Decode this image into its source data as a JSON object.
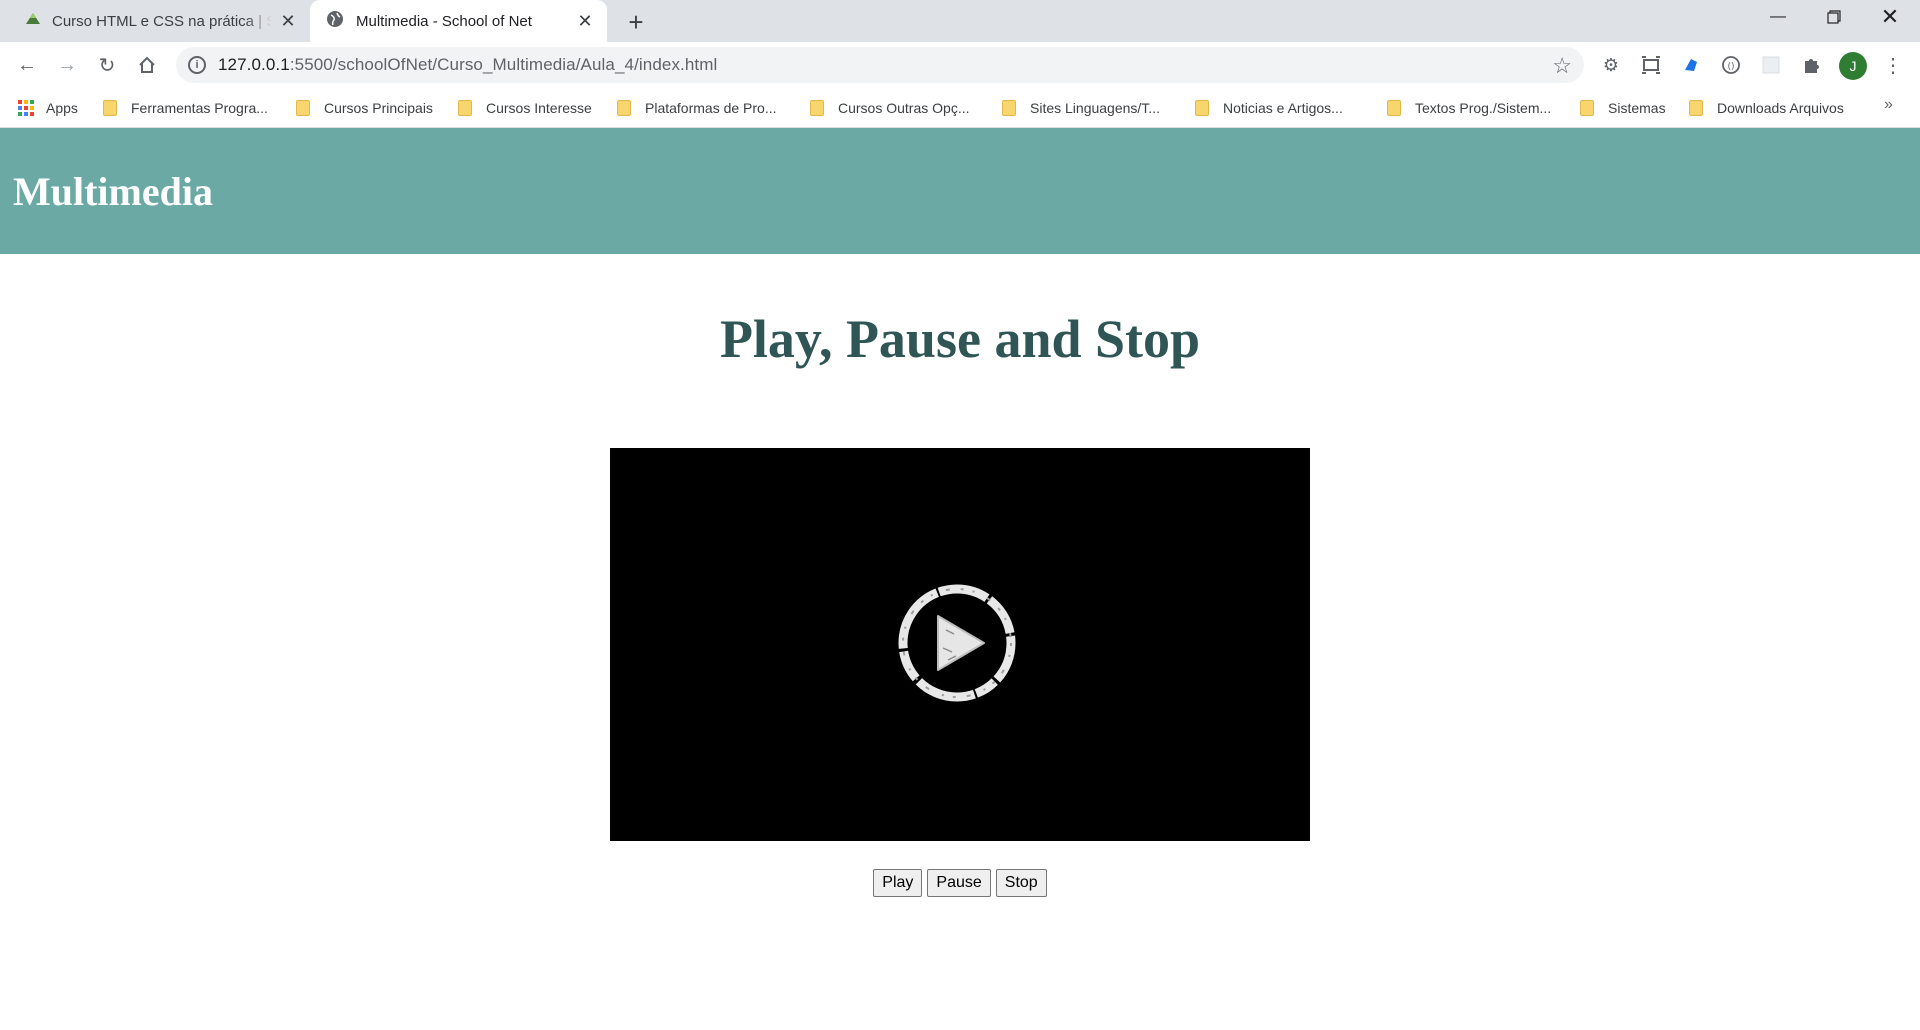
{
  "browser": {
    "tabs": [
      {
        "title": "Curso HTML e CSS na prática | Sc",
        "favicon": "school-of-net-icon",
        "active": false
      },
      {
        "title": "Multimedia - School of Net",
        "favicon": "globe-icon",
        "active": true
      }
    ],
    "new_tab_icon": "plus-icon",
    "window_controls": [
      "minimize-icon",
      "restore-icon",
      "close-icon"
    ],
    "url_host": "127.0.0.1",
    "url_rest": ":5500/schoolOfNet/Curso_Multimedia/Aula_4/index.html",
    "avatar_letter": "J",
    "bookmarks": [
      {
        "label": "Apps",
        "icon": "apps-grid-icon"
      },
      {
        "label": "Ferramentas Progra...",
        "icon": "folder-icon"
      },
      {
        "label": "Cursos Principais",
        "icon": "folder-icon"
      },
      {
        "label": "Cursos Interesse",
        "icon": "folder-icon"
      },
      {
        "label": "Plataformas de Pro...",
        "icon": "folder-icon"
      },
      {
        "label": "Cursos Outras Opç...",
        "icon": "folder-icon"
      },
      {
        "label": "Sites Linguagens/T...",
        "icon": "folder-icon"
      },
      {
        "label": "Noticias e Artigos...",
        "icon": "folder-icon"
      },
      {
        "label": "Textos Prog./Sistem...",
        "icon": "folder-icon"
      },
      {
        "label": "Sistemas",
        "icon": "folder-icon"
      },
      {
        "label": "Downloads Arquivos",
        "icon": "folder-icon"
      }
    ],
    "bookmarks_overflow": "»"
  },
  "page": {
    "header_title": "Multimedia",
    "title": "Play, Pause and Stop",
    "video_overlay_icon": "play-circle-icon",
    "buttons": {
      "play": "Play",
      "pause": "Pause",
      "stop": "Stop"
    }
  },
  "colors": {
    "header_bg": "#6ba9a5",
    "title_color": "#2f5554",
    "video_bg": "#000000"
  }
}
